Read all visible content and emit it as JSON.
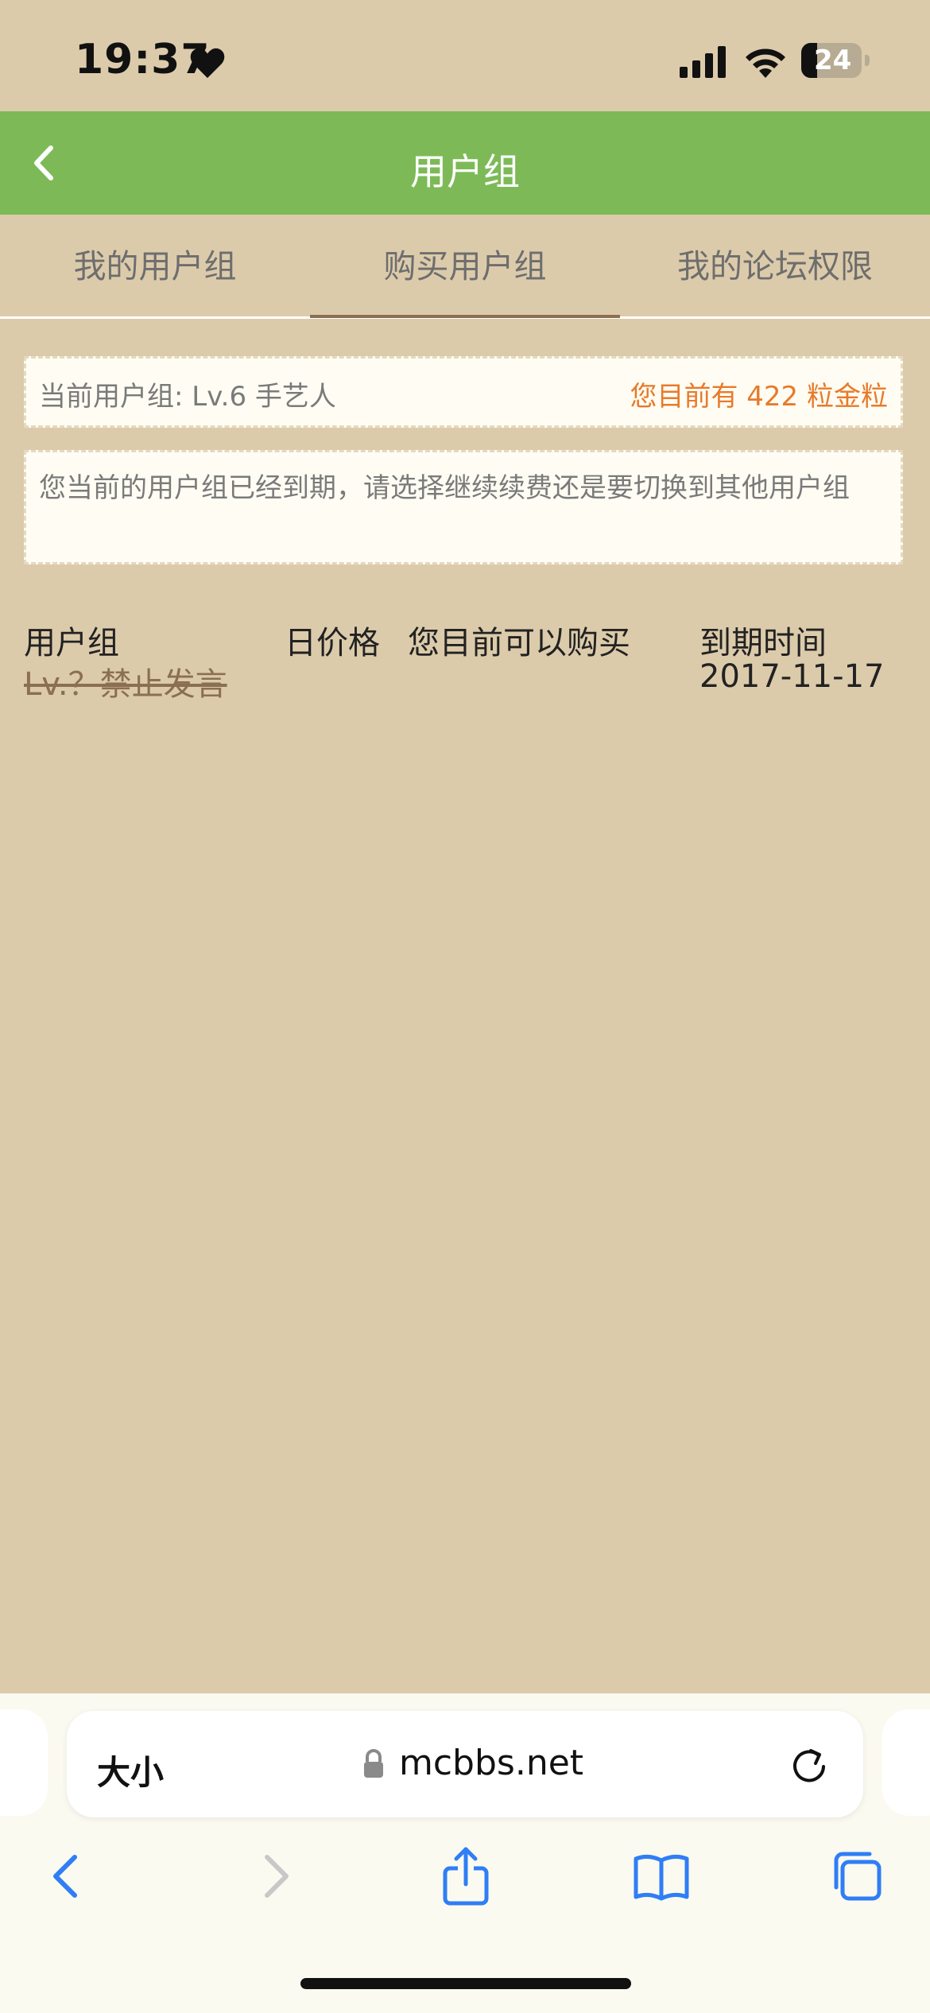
{
  "status_bar": {
    "time": "19:37",
    "battery": "24"
  },
  "header": {
    "title": "用户组"
  },
  "tabs": [
    {
      "label": "我的用户组",
      "active": false
    },
    {
      "label": "购买用户组",
      "active": true
    },
    {
      "label": "我的论坛权限",
      "active": false
    }
  ],
  "notice_current": {
    "left": "当前用户组: Lv.6 手艺人",
    "right": "您目前有 422 粒金粒"
  },
  "notice_expired": {
    "text": "您当前的用户组已经到期，请选择继续续费还是要切换到其他用户组"
  },
  "table": {
    "headers": [
      "用户组",
      "日价格",
      "您目前可以购买",
      "到期时间"
    ],
    "rows": [
      {
        "group": "Lv.？禁止发言",
        "price": "",
        "can_buy": "",
        "expiry": "2017-11-17"
      }
    ]
  },
  "browser": {
    "text_size_label": "大小",
    "url": "mcbbs.net"
  },
  "colors": {
    "header": "#7dba57",
    "page_bg": "#dccbab",
    "accent_orange": "#e87a2a",
    "tab_underline": "#8b6f52"
  }
}
